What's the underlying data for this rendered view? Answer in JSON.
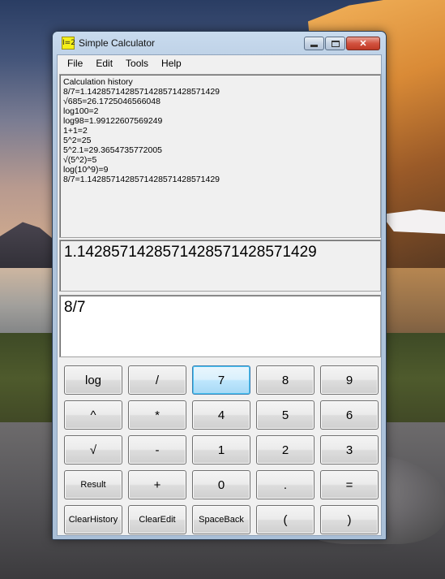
{
  "window": {
    "title": "Simple Calculator",
    "icon_text": "I=2",
    "close_glyph": "✕"
  },
  "menu": [
    "File",
    "Edit",
    "Tools",
    "Help"
  ],
  "history": {
    "lines": [
      "Calculation history",
      "8/7=1.1428571428571428571428571429",
      "√685=26.1725046566048",
      "log100=2",
      "log98=1.99122607569249",
      "1+1=2",
      "5^2=25",
      "5^2.1=29.3654735772005",
      "√(5^2)=5",
      "log(10^9)=9",
      "8/7=1.1428571428571428571428571429"
    ]
  },
  "result": "1.1428571428571428571428571429",
  "input": "8/7",
  "keys": [
    {
      "label": "log",
      "name": "log-button"
    },
    {
      "label": "/",
      "name": "divide-button"
    },
    {
      "label": "7",
      "name": "digit-7-button",
      "focused": true
    },
    {
      "label": "8",
      "name": "digit-8-button"
    },
    {
      "label": "9",
      "name": "digit-9-button"
    },
    {
      "label": "^",
      "name": "power-button"
    },
    {
      "label": "*",
      "name": "multiply-button"
    },
    {
      "label": "4",
      "name": "digit-4-button"
    },
    {
      "label": "5",
      "name": "digit-5-button"
    },
    {
      "label": "6",
      "name": "digit-6-button"
    },
    {
      "label": "√",
      "name": "sqrt-button"
    },
    {
      "label": "-",
      "name": "subtract-button"
    },
    {
      "label": "1",
      "name": "digit-1-button"
    },
    {
      "label": "2",
      "name": "digit-2-button"
    },
    {
      "label": "3",
      "name": "digit-3-button"
    },
    {
      "label": "Result",
      "name": "result-button",
      "small": true
    },
    {
      "label": "+",
      "name": "add-button"
    },
    {
      "label": "0",
      "name": "digit-0-button"
    },
    {
      "label": ".",
      "name": "decimal-button"
    },
    {
      "label": "=",
      "name": "equals-button"
    },
    {
      "label": "ClearHistory",
      "name": "clear-history-button",
      "small": true
    },
    {
      "label": "ClearEdit",
      "name": "clear-edit-button",
      "small": true
    },
    {
      "label": "SpaceBack",
      "name": "space-back-button",
      "small": true
    },
    {
      "label": "(",
      "name": "open-paren-button"
    },
    {
      "label": ")",
      "name": "close-paren-button"
    }
  ]
}
